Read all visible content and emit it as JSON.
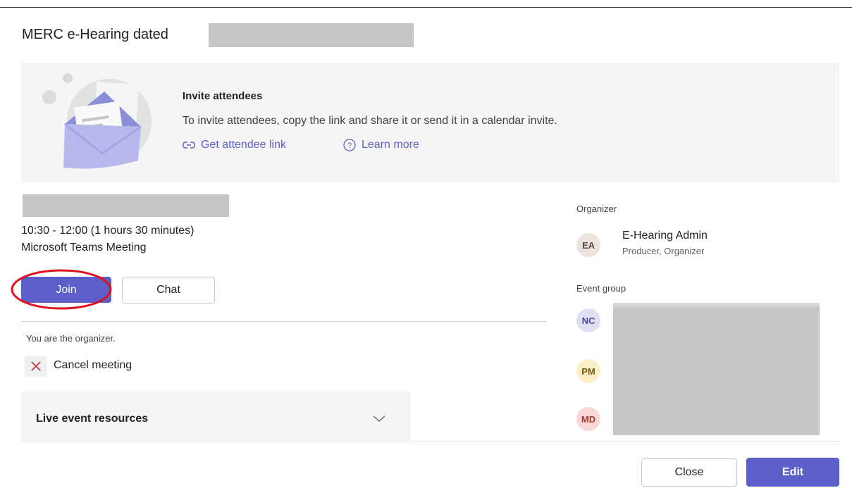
{
  "meeting": {
    "title": "MERC e-Hearing dated",
    "time": "10:30 - 12:00 (1 hours 30 minutes)",
    "location": "Microsoft Teams Meeting"
  },
  "invite": {
    "title": "Invite attendees",
    "description": "To invite attendees, copy the link and share it or send it in a calendar invite.",
    "get_link_label": "Get attendee link",
    "learn_more_label": "Learn more"
  },
  "actions": {
    "join_label": "Join",
    "chat_label": "Chat"
  },
  "organizer_note": "You are the organizer.",
  "cancel_label": "Cancel meeting",
  "resources": {
    "title": "Live event resources"
  },
  "organizer_section": {
    "label": "Organizer",
    "person": {
      "initials": "EA",
      "name": "E-Hearing Admin",
      "role": "Producer, Organizer"
    }
  },
  "event_group": {
    "label": "Event group",
    "members": [
      {
        "initials": "NC",
        "bg": "#dfe0f3",
        "fg": "#4b4f9c"
      },
      {
        "initials": "PM",
        "bg": "#fcefc8",
        "fg": "#7a5a12"
      },
      {
        "initials": "MD",
        "bg": "#f8d8d4",
        "fg": "#9c3b2f"
      }
    ]
  },
  "footer": {
    "close_label": "Close",
    "edit_label": "Edit"
  },
  "colors": {
    "accent": "#5b5fc7",
    "annotation_red": "#e0101c"
  }
}
